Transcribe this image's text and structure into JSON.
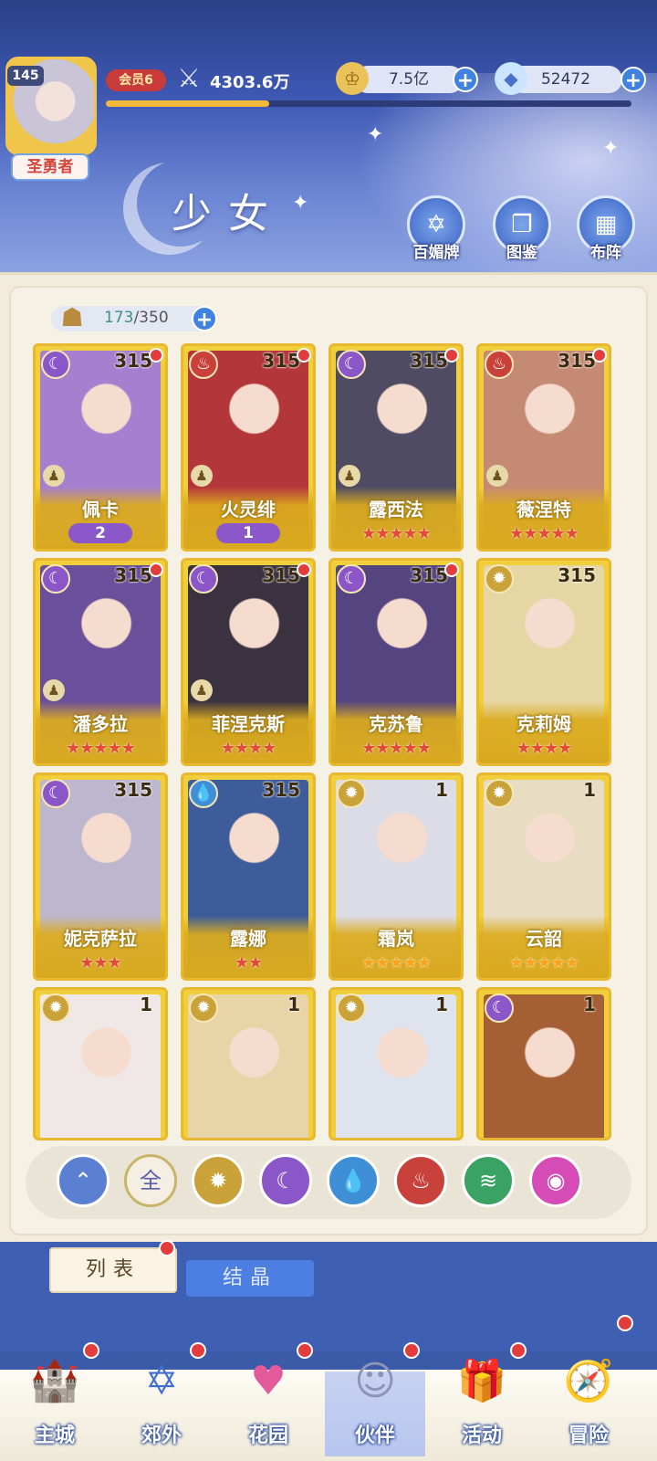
{
  "header": {
    "level": "145",
    "title_badge": "圣勇者",
    "vip": "会员6",
    "power": "4303.6万",
    "xp_progress": 0.31,
    "gold": "7.5亿",
    "diamonds": "52472",
    "page_title": "少女",
    "buttons": [
      {
        "label": "百媚牌",
        "icon": "card-deck-icon"
      },
      {
        "label": "图鉴",
        "icon": "book-icon"
      },
      {
        "label": "布阵",
        "icon": "grid-icon"
      }
    ]
  },
  "capacity": {
    "current": "173",
    "max": "/350"
  },
  "cards": [
    {
      "name": "佩卡",
      "level": "315",
      "element": "moon",
      "badge": "2",
      "stars": "",
      "star_color": "",
      "dot": true,
      "pawn": true,
      "bg": "#a77fcf"
    },
    {
      "name": "火灵绯",
      "level": "315",
      "element": "fire",
      "badge": "1",
      "stars": "",
      "star_color": "",
      "dot": true,
      "pawn": true,
      "bg": "#b3363b"
    },
    {
      "name": "露西法",
      "level": "315",
      "element": "moon",
      "badge": "",
      "stars": "★★★★★",
      "star_color": "red",
      "dot": true,
      "pawn": true,
      "bg": "#4f4b63"
    },
    {
      "name": "薇涅特",
      "level": "315",
      "element": "fire",
      "badge": "",
      "stars": "★★★★★",
      "star_color": "red",
      "dot": true,
      "pawn": true,
      "bg": "#c58a74"
    },
    {
      "name": "潘多拉",
      "level": "315",
      "element": "moon",
      "badge": "",
      "stars": "★★★★★",
      "star_color": "red",
      "dot": true,
      "pawn": true,
      "bg": "#6a4f9a"
    },
    {
      "name": "菲涅克斯",
      "level": "315",
      "element": "moon",
      "badge": "",
      "stars": "★★★★",
      "star_color": "red",
      "dot": true,
      "pawn": true,
      "bg": "#3b3240"
    },
    {
      "name": "克苏鲁",
      "level": "315",
      "element": "moon",
      "badge": "",
      "stars": "★★★★★",
      "star_color": "red",
      "dot": true,
      "pawn": false,
      "bg": "#54447f"
    },
    {
      "name": "克莉姆",
      "level": "315",
      "element": "sun",
      "badge": "",
      "stars": "★★★★",
      "star_color": "red",
      "dot": false,
      "pawn": false,
      "bg": "#e6d6a4"
    },
    {
      "name": "妮克萨拉",
      "level": "315",
      "element": "moon",
      "badge": "",
      "stars": "★★★",
      "star_color": "red",
      "dot": false,
      "pawn": false,
      "bg": "#bcb6cf"
    },
    {
      "name": "露娜",
      "level": "315",
      "element": "water",
      "badge": "",
      "stars": "★★",
      "star_color": "red",
      "dot": false,
      "pawn": false,
      "bg": "#3e5c9a"
    },
    {
      "name": "霜岚",
      "level": "1",
      "element": "sun",
      "badge": "",
      "stars": "★★★★★",
      "star_color": "gold",
      "dot": false,
      "pawn": false,
      "bg": "#dcdce6"
    },
    {
      "name": "云韶",
      "level": "1",
      "element": "sun",
      "badge": "",
      "stars": "★★★★★",
      "star_color": "gold",
      "dot": false,
      "pawn": false,
      "bg": "#e8dcc2"
    },
    {
      "name": "",
      "level": "1",
      "element": "sun",
      "badge": "",
      "stars": "",
      "star_color": "",
      "dot": false,
      "pawn": false,
      "bg": "#efe8e6"
    },
    {
      "name": "",
      "level": "1",
      "element": "sun",
      "badge": "",
      "stars": "",
      "star_color": "",
      "dot": false,
      "pawn": false,
      "bg": "#e9d4a8"
    },
    {
      "name": "",
      "level": "1",
      "element": "sun",
      "badge": "",
      "stars": "",
      "star_color": "",
      "dot": false,
      "pawn": false,
      "bg": "#dfe3ee"
    },
    {
      "name": "",
      "level": "1",
      "element": "moon",
      "badge": "",
      "stars": "",
      "star_color": "",
      "dot": false,
      "pawn": false,
      "bg": "#a55f34"
    }
  ],
  "filters": [
    {
      "name": "sort-icon",
      "label": "",
      "color": "#5b7fd1"
    },
    {
      "name": "all-icon",
      "label": "全",
      "color": "#f4efe2"
    },
    {
      "name": "sun-icon",
      "label": "",
      "color": "#c9a23a"
    },
    {
      "name": "moon-icon",
      "label": "",
      "color": "#8b56c7"
    },
    {
      "name": "water-icon",
      "label": "",
      "color": "#3f8fd6"
    },
    {
      "name": "fire-icon",
      "label": "",
      "color": "#c8413b"
    },
    {
      "name": "wind-icon",
      "label": "",
      "color": "#3aa262"
    },
    {
      "name": "heart-icon",
      "label": "",
      "color": "#d64cb6"
    }
  ],
  "tabs": {
    "list": "列表",
    "crystal": "结晶"
  },
  "nav": [
    {
      "label": "主城",
      "icon": "castle-icon"
    },
    {
      "label": "郊外",
      "icon": "portal-icon"
    },
    {
      "label": "花园",
      "icon": "heart-garden-icon"
    },
    {
      "label": "伙伴",
      "icon": "partner-icon"
    },
    {
      "label": "活动",
      "icon": "gift-icon"
    },
    {
      "label": "冒险",
      "icon": "compass-icon"
    }
  ],
  "colors": {
    "card_gold": "#f0cf3a",
    "red_dot": "#e23c3c",
    "accent_blue": "#3f82e0"
  }
}
